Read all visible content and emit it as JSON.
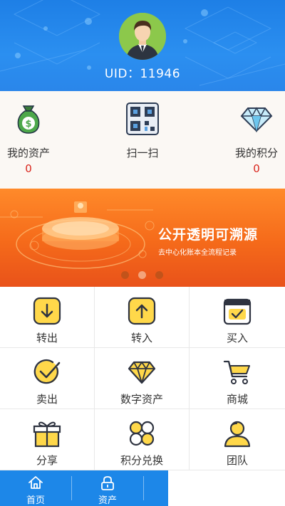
{
  "header": {
    "uid_text": "UID：11946"
  },
  "stats": {
    "assets_label": "我的资产",
    "assets_value": "0",
    "scan_label": "扫一扫",
    "points_label": "我的积分",
    "points_value": "0"
  },
  "banner": {
    "title": "公开透明可溯源",
    "subtitle": "去中心化账本全流程记录",
    "active_slide": 2,
    "slide_count": 3
  },
  "grid": {
    "items": [
      {
        "label": "转出",
        "icon": "transfer-out-icon"
      },
      {
        "label": "转入",
        "icon": "transfer-in-icon"
      },
      {
        "label": "买入",
        "icon": "buy-icon"
      },
      {
        "label": "卖出",
        "icon": "sell-icon"
      },
      {
        "label": "数字资产",
        "icon": "diamond-icon"
      },
      {
        "label": "商城",
        "icon": "cart-icon"
      },
      {
        "label": "分享",
        "icon": "gift-icon"
      },
      {
        "label": "积分兑换",
        "icon": "points-exchange-icon"
      },
      {
        "label": "团队",
        "icon": "team-icon"
      }
    ]
  },
  "nav": {
    "home_label": "首页",
    "assets_label": "资产"
  },
  "colors": {
    "primary": "#1e87e8",
    "accent": "#ffd84a",
    "banner": "#f56a1a",
    "value_red": "#d9251c"
  }
}
